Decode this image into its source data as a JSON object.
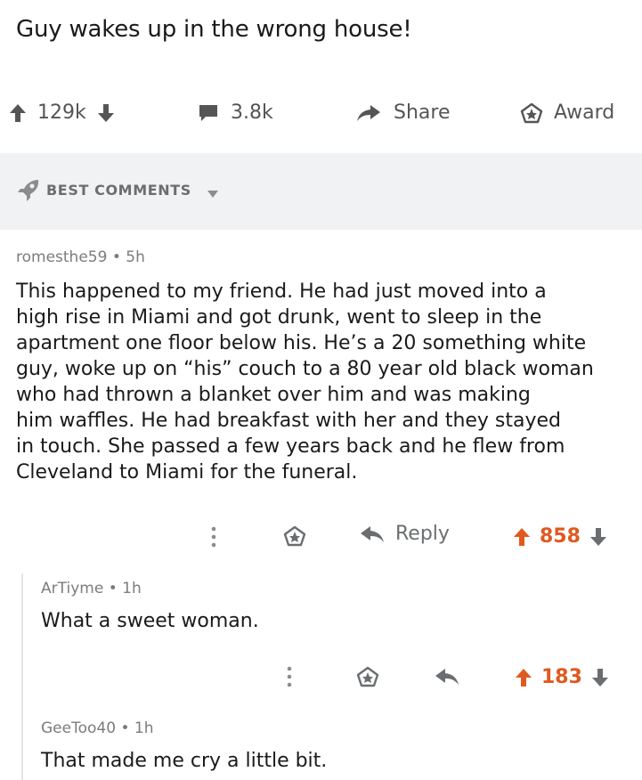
{
  "post": {
    "title": "Guy wakes up in the wrong house!",
    "upvotes": "129k",
    "comments": "3.8k",
    "share_label": "Share",
    "award_label": "Award"
  },
  "sort": {
    "label": "BEST COMMENTS"
  },
  "comments": [
    {
      "author": "romesthe59",
      "age": "5h",
      "lines": [
        "This happened to my friend. He had just moved into a",
        "high rise in Miami and got drunk, went to sleep in the",
        "apartment one floor below his.  He’s a 20 something white",
        "guy, woke up on “his” couch to a 80 year old black woman",
        "who had thrown a blanket over him and was making",
        "him waffles. He had breakfast with her and they stayed",
        "in touch. She passed a few years back and he flew from",
        "Cleveland to Miami for the funeral."
      ],
      "reply_label": "Reply",
      "score": "858"
    },
    {
      "author": "ArTiyme",
      "age": "1h",
      "text": "What a sweet woman.",
      "score": "183"
    },
    {
      "author": "GeeToo40",
      "age": "1h",
      "text": "That made me cry a little bit."
    }
  ],
  "colors": {
    "upvote": "#e0591f",
    "sort_bg": "#f1f2f3",
    "muted_text": "#7c7c7c"
  },
  "icons": [
    "upvote-arrow-icon",
    "downvote-arrow-icon",
    "comment-icon",
    "share-arrow-icon",
    "award-icon",
    "rocket-icon",
    "caret-down-icon",
    "more-vert-icon",
    "reply-arrow-icon"
  ]
}
